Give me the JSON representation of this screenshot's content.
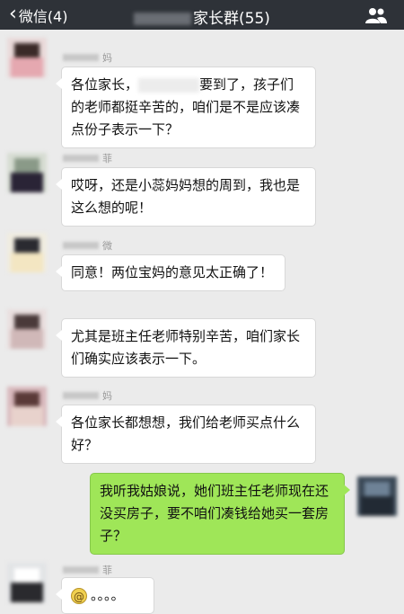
{
  "header": {
    "back_label": "微信(4)",
    "title_suffix": "家长群(55)",
    "menu_icon": "group-people-icon"
  },
  "messages": [
    {
      "side": "left",
      "nick_suffix": "妈",
      "text_before": "各位家长，",
      "text_after": "要到了，孩子们的老师都挺辛苦的，咱们是不是应该凑点份子表示一下？"
    },
    {
      "side": "left",
      "nick_suffix": "菲",
      "text": "哎呀，还是小蕊妈妈想的周到，我也是这么想的呢！"
    },
    {
      "side": "left",
      "nick_suffix": "微",
      "text": "同意！两位宝妈的意见太正确了！"
    },
    {
      "side": "left",
      "nick_suffix": "",
      "text": "尤其是班主任老师特别辛苦，咱们家长们确实应该表示一下。"
    },
    {
      "side": "left",
      "nick_suffix": "妈",
      "text": "各位家长都想想，我们给老师买点什么好？"
    },
    {
      "side": "right",
      "text": "我听我姑娘说，她们班主任老师现在还没买房子，要不咱们凑钱给她买一套房子？"
    },
    {
      "side": "left",
      "nick_suffix": "菲",
      "emoji": "angry-face-emoji",
      "text": "。。。。"
    }
  ]
}
